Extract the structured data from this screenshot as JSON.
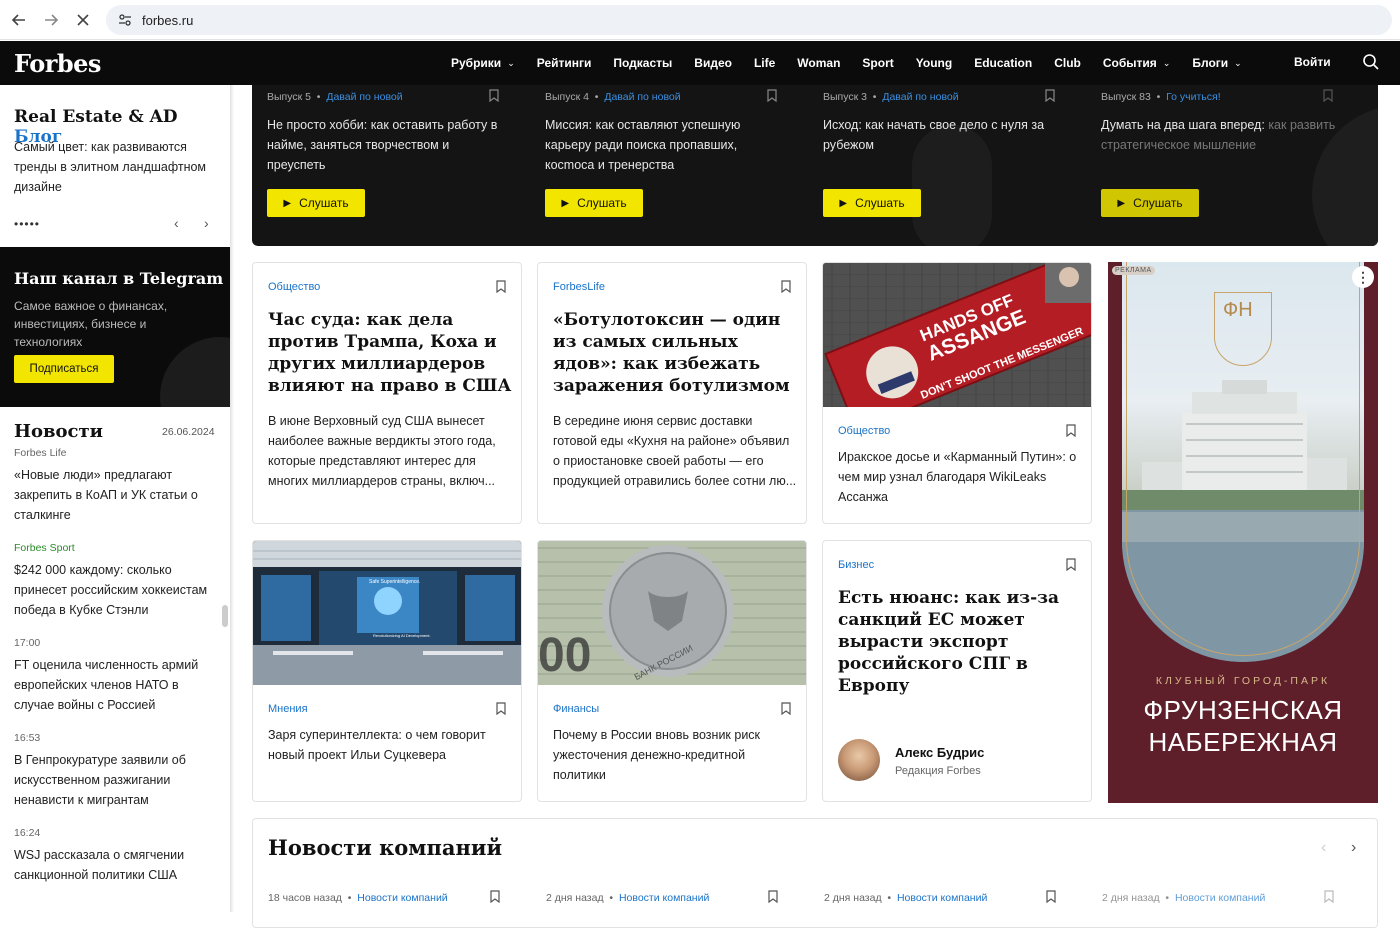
{
  "browser": {
    "url": "forbes.ru"
  },
  "nav": {
    "logo": "Forbes",
    "items": [
      "Рубрики",
      "Рейтинги",
      "Подкасты",
      "Видео",
      "Life",
      "Woman",
      "Sport",
      "Young",
      "Education",
      "Club",
      "События",
      "Блоги"
    ],
    "login": "Войти"
  },
  "sidebar": {
    "blog_title": "Real Estate & AD",
    "blog_link": "Блог",
    "blog_text": "Самый цвет: как развиваются тренды в элитном ландшафтном дизайне",
    "dots": "•••••",
    "telegram_title": "Наш канал в Telegram",
    "telegram_text": "Самое важное о финансах, инвестициях, бизнесе и технологиях",
    "telegram_button": "Подписаться",
    "news_title": "Новости",
    "news_date": "26.06.2024",
    "news": [
      {
        "tag": "Forbes Life",
        "text": "«Новые люди» предлагают закрепить в КоАП и УК статьи о сталкинге"
      },
      {
        "tag": "Forbes Sport",
        "text": "$242 000 каждому: сколько принесет российским хоккеистам победа в Кубке Стэнли"
      },
      {
        "tag": "17:00",
        "text": "FT оценила численность армий европейских членов НАТО в случае войны с Россией"
      },
      {
        "tag": "16:53",
        "text": "В Генпрокуратуре заявили об искусственном разжигании ненависти к мигрантам"
      },
      {
        "tag": "16:24",
        "text": "WSJ рассказала о смягчении санкционной политики США"
      }
    ]
  },
  "podcasts": [
    {
      "issue": "Выпуск 5",
      "series": "Давай по новой",
      "title": "Не просто хобби: как оставить работу в найме, заняться творчеством и преуспеть",
      "title_dim": "",
      "button": "Слушать"
    },
    {
      "issue": "Выпуск 4",
      "series": "Давай по новой",
      "title": "Миссия: как оставляют успешную карьеру ради поиска пропавших, косmоса и тренерства",
      "title_dim": "",
      "button": "Слушать"
    },
    {
      "issue": "Выпуск 3",
      "series": "Давай по новой",
      "title": "Исход: как начать свое дело с нуля за рубежом",
      "title_dim": "",
      "button": "Слушать"
    },
    {
      "issue": "Выпуск 83",
      "series": "Го учиться!",
      "title": "Думать на два шага вперед: ",
      "title_dim": "как развить стратегическое мышление",
      "button": "Слушать"
    }
  ],
  "cards": {
    "c1": {
      "tag": "Общество",
      "title": "Час суда: как дела против Трампа, Коха и других миллиардеров влияют на право в США",
      "lead": "В июне Верховный суд США вынесет наиболее важные вердикты этого года, которые представляют интерес для многих миллиардеров страны, включ..."
    },
    "c2": {
      "tag": "ForbesLife",
      "title": "«Ботулотоксин — один из самых сильных ядов»: как избежать заражения ботулизмом",
      "lead": "В середине июня сервис доставки готовой еды «Кухня на районе» объявил о приостановке своей работы — его продукцией отравились более сотни лю..."
    },
    "c3": {
      "tag": "Общество",
      "text": "Иракское досье и «Карманный Путин»: о чем мир узнал благодаря WikiLeaks Ассанжа",
      "img_banner_1": "HANDS OFF",
      "img_banner_2": "ASSANGE",
      "img_banner_3": "DON'T SHOOT THE MESSENGER"
    },
    "c4": {
      "tag": "Мнения",
      "text": "Заря суперинтеллекта: о чем говорит новый проект Ильи Суцкевера",
      "screen_caption": "Safe Superintelligence.",
      "screen_sub": "Revolutionizing AI Development."
    },
    "c5": {
      "tag": "Финансы",
      "text": "Почему в России вновь возник риск ужесточения денежно-кредитной политики",
      "coin_text": "БАНК РОССИИ"
    },
    "c6": {
      "tag": "Бизнес",
      "title": "Есть нюанс: как из-за санкций ЕС может вырасти экспорт российского СПГ в Европу",
      "author": "Алекс Будрис",
      "role": "Редакция Forbes"
    }
  },
  "ad": {
    "label": "РЕКЛАМА",
    "kebab": "⋮",
    "subtitle": "КЛУБНЫЙ ГОРОД-ПАРК",
    "title_1": "ФРУНЗЕНСКАЯ",
    "title_2": "НАБЕРЕЖНАЯ",
    "logo_letters": "ФН"
  },
  "companies": {
    "title": "Новости компаний",
    "items": [
      {
        "time": "18 часов назад",
        "tag": "Новости компаний"
      },
      {
        "time": "2 дня назад",
        "tag": "Новости компаний"
      },
      {
        "time": "2 дня назад",
        "tag": "Новости компаний"
      },
      {
        "time": "2 дня назад",
        "tag": "Новости компаний"
      }
    ]
  },
  "colors": {
    "accent_yellow": "#f2e600",
    "link_blue": "#1a73c8",
    "dark": "#0b0b0b",
    "ad_bg": "#5e1f2a"
  }
}
